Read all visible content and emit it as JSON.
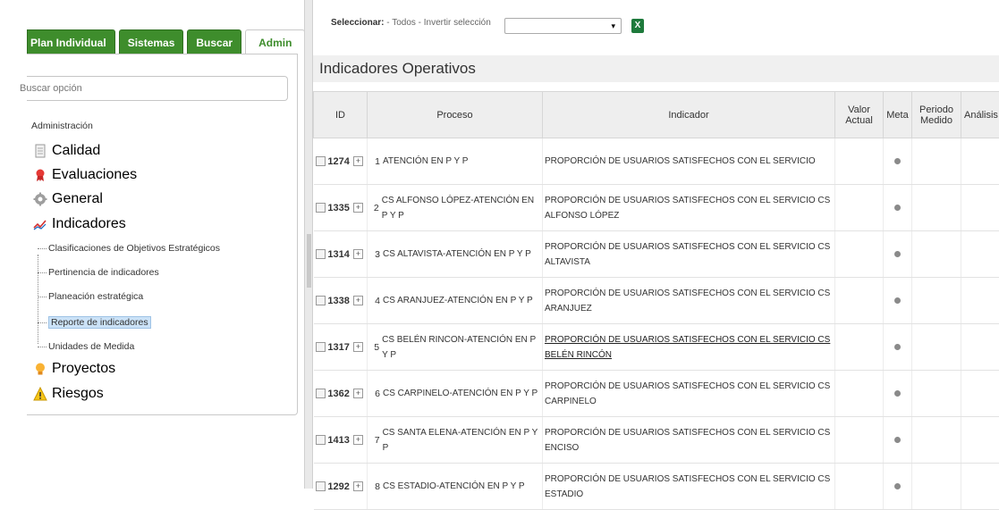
{
  "nav": {
    "tabs": [
      {
        "label": "Plan Individual"
      },
      {
        "label": "Sistemas"
      },
      {
        "label": "Buscar"
      },
      {
        "label": "Admin"
      }
    ],
    "search_placeholder": "Buscar opción",
    "tree": {
      "root": "Administración",
      "items": [
        {
          "label": "Calidad",
          "icon": "document-icon"
        },
        {
          "label": "Evaluaciones",
          "icon": "ribbon-icon"
        },
        {
          "label": "General",
          "icon": "gear-icon"
        },
        {
          "label": "Indicadores",
          "icon": "chart-line-icon"
        }
      ],
      "sub_items": [
        {
          "label": "Clasificaciones de Objetivos Estratégicos"
        },
        {
          "label": "Pertinencia de indicadores"
        },
        {
          "label": "Planeación estratégica"
        },
        {
          "label": "Reporte de indicadores",
          "selected": true
        },
        {
          "label": "Unidades de Medida"
        }
      ],
      "items_after": [
        {
          "label": "Proyectos",
          "icon": "lightbulb-icon"
        },
        {
          "label": "Riesgos",
          "icon": "warning-icon"
        }
      ]
    }
  },
  "toolbar": {
    "select_label": "Seleccionar:",
    "select_options": "- Todos - Invertir selección"
  },
  "page_title": "Indicadores Operativos",
  "table": {
    "columns": [
      "ID",
      "Proceso",
      "Indicador",
      "Valor Actual",
      "Meta",
      "Periodo Medido",
      "Análisis"
    ],
    "rows": [
      {
        "id": "1274",
        "n": "1",
        "proceso": "ATENCIÓN EN P Y P",
        "indicador": "PROPORCIÓN DE USUARIOS SATISFECHOS CON EL SERVICIO"
      },
      {
        "id": "1335",
        "n": "2",
        "proceso": "CS ALFONSO LÓPEZ-ATENCIÓN EN P Y P",
        "indicador": "PROPORCIÓN DE USUARIOS SATISFECHOS CON EL SERVICIO CS ALFONSO LÓPEZ"
      },
      {
        "id": "1314",
        "n": "3",
        "proceso": "CS ALTAVISTA-ATENCIÓN EN P Y P",
        "indicador": "PROPORCIÓN DE USUARIOS SATISFECHOS CON EL SERVICIO CS ALTAVISTA"
      },
      {
        "id": "1338",
        "n": "4",
        "proceso": "CS ARANJUEZ-ATENCIÓN EN P Y P",
        "indicador": "PROPORCIÓN DE USUARIOS SATISFECHOS CON EL SERVICIO CS ARANJUEZ"
      },
      {
        "id": "1317",
        "n": "5",
        "proceso": "CS BELÉN RINCON-ATENCIÓN EN P Y P",
        "indicador": "PROPORCIÓN DE USUARIOS SATISFECHOS CON EL SERVICIO CS BELÉN RINCÓN",
        "link": true
      },
      {
        "id": "1362",
        "n": "6",
        "proceso": "CS CARPINELO-ATENCIÓN EN P Y P",
        "indicador": "PROPORCIÓN DE USUARIOS SATISFECHOS CON EL SERVICIO CS CARPINELO"
      },
      {
        "id": "1413",
        "n": "7",
        "proceso": "CS SANTA ELENA-ATENCIÓN EN P Y P",
        "indicador": "PROPORCIÓN DE USUARIOS SATISFECHOS CON EL SERVICIO CS ENCISO"
      },
      {
        "id": "1292",
        "n": "8",
        "proceso": "CS ESTADIO-ATENCIÓN EN P Y P",
        "indicador": "PROPORCIÓN DE USUARIOS SATISFECHOS CON EL SERVICIO CS ESTADIO"
      }
    ]
  },
  "colors": {
    "tab_green": "#3e8d2c",
    "selected_bg": "#cbe2f7",
    "excel_green": "#1e7a3c"
  }
}
